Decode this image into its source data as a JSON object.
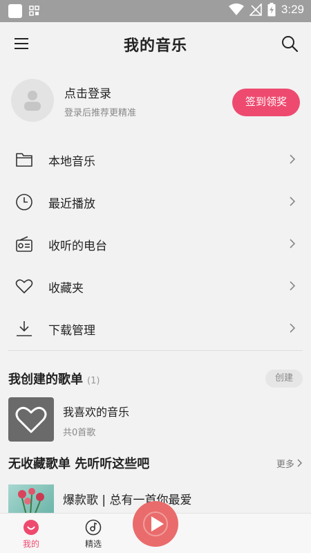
{
  "status_bar": {
    "time": "3:29"
  },
  "header": {
    "title": "我的音乐"
  },
  "login": {
    "title": "点击登录",
    "subtitle": "登录后推荐更精准",
    "signin_label": "签到领奖"
  },
  "menu": {
    "items": [
      {
        "label": "本地音乐",
        "icon": "folder-icon"
      },
      {
        "label": "最近播放",
        "icon": "clock-icon"
      },
      {
        "label": "收听的电台",
        "icon": "radio-icon"
      },
      {
        "label": "收藏夹",
        "icon": "heart-icon"
      },
      {
        "label": "下载管理",
        "icon": "download-icon"
      }
    ]
  },
  "created": {
    "title": "我创建的歌单",
    "count": "(1)",
    "create_label": "创建"
  },
  "playlist": {
    "name": "我喜欢的音乐",
    "count": "共0首歌"
  },
  "recommend": {
    "title": "无收藏歌单 先听听这些吧",
    "more_label": "更多",
    "item_name": "爆款歌 | 总有一首你最爱"
  },
  "tabs": {
    "mine": "我的",
    "picks": "精选"
  },
  "colors": {
    "accent": "#ee4a6f",
    "play": "#ea6b6b",
    "status_bar": "#9e9e9e"
  }
}
